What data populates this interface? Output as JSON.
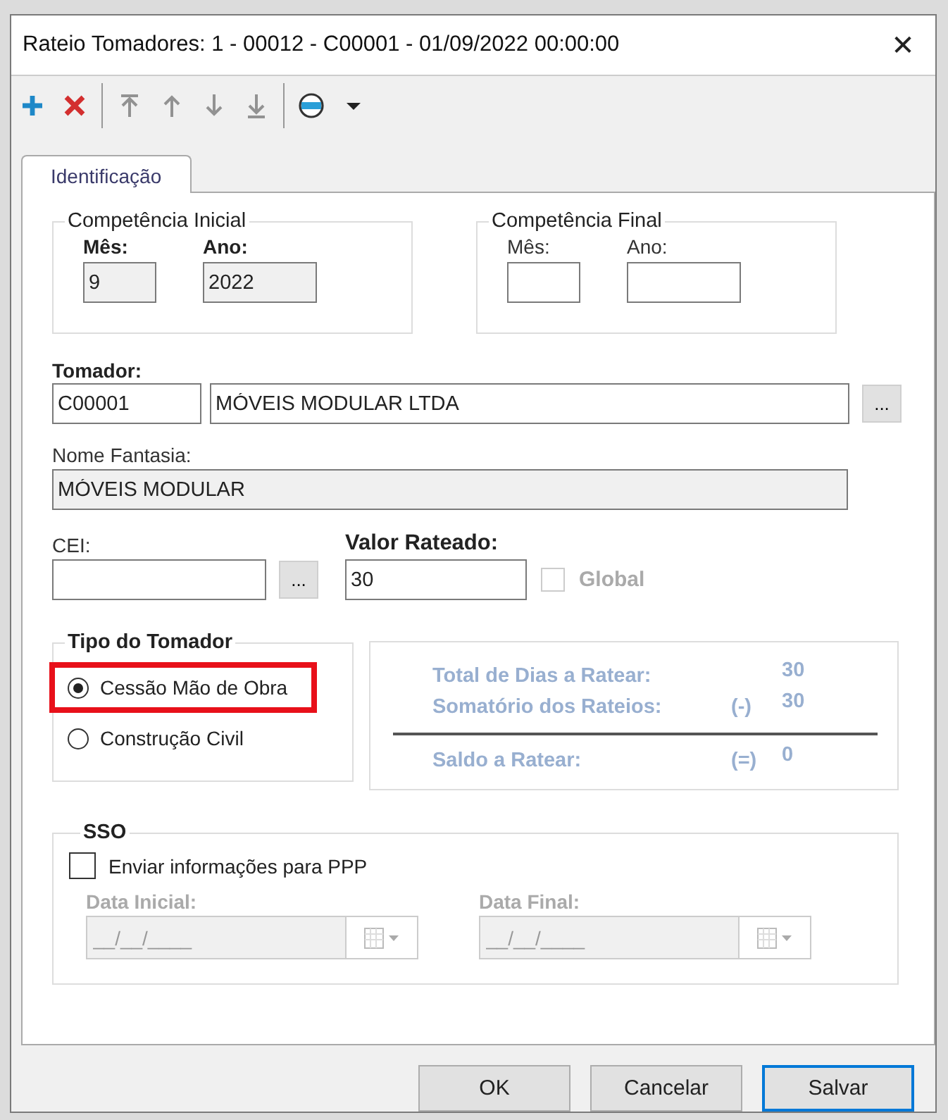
{
  "window": {
    "title": "Rateio Tomadores: 1 - 00012 - C00001 - 01/09/2022 00:00:00",
    "close": "✕"
  },
  "toolbar": [
    {
      "buttons": [
        {
          "kind": "add",
          "disabled": false
        },
        {
          "kind": "delete",
          "disabled": false
        }
      ]
    },
    {
      "buttons": [
        {
          "kind": "first",
          "disabled": true
        },
        {
          "kind": "up",
          "disabled": true
        },
        {
          "kind": "down",
          "disabled": true
        },
        {
          "kind": "last",
          "disabled": true
        }
      ]
    },
    {
      "buttons": [
        {
          "kind": "web",
          "disabled": false
        },
        {
          "kind": "dropdown",
          "disabled": false
        }
      ]
    }
  ],
  "tabs": [
    {
      "label": "Identificação",
      "selected": true
    }
  ],
  "competencias": [
    {
      "title": "Competência Inicial",
      "fields": [
        {
          "label": "Mês:",
          "value": "9",
          "required": true,
          "disabled": true
        },
        {
          "label": "Ano:",
          "value": "2022",
          "required": true,
          "disabled": true
        }
      ]
    },
    {
      "title": "Competência Final",
      "fields": [
        {
          "label": "Mês:",
          "required": false,
          "disabled": false
        },
        {
          "label": "Ano:",
          "required": false,
          "disabled": false
        }
      ]
    }
  ],
  "tomador": {
    "label": "Tomador:",
    "code": "C00001",
    "name": "MÓVEIS MODULAR LTDA",
    "button": "..."
  },
  "nome_fantasia": {
    "label": "Nome Fantasia:",
    "value": "MÓVEIS MODULAR",
    "disabled": true
  },
  "cei": {
    "label": "CEI:",
    "button": "..."
  },
  "valor_rateado": {
    "label": "Valor Rateado:",
    "value": "30"
  },
  "global": {
    "label": "Global",
    "checked": false,
    "disabled": true
  },
  "tipo_do_tomador": {
    "title": "Tipo do Tomador",
    "options": [
      {
        "label": "Cessão Mão de Obra",
        "selected": true,
        "highlighted": true
      },
      {
        "label": "Construção Civil",
        "selected": false,
        "highlighted": false
      }
    ]
  },
  "summary": [
    {
      "label": "Total de Dias a Ratear:",
      "value": "30"
    },
    {
      "label": "Somatório dos Rateios:",
      "sign": "(-)",
      "value": "30"
    },
    {
      "label": "Saldo a Ratear:",
      "sign": "(=)",
      "value": "0"
    }
  ],
  "sso": {
    "title": "SSO",
    "checkbox": {
      "label": "Enviar informações para PPP",
      "checked": false
    },
    "dates": [
      {
        "label": "Data Inicial:",
        "placeholder": "__/__/____",
        "disabled": true
      },
      {
        "label": "Data Final:",
        "placeholder": "__/__/____",
        "disabled": true
      }
    ]
  },
  "buttons": [
    {
      "label": "OK",
      "focused": false
    },
    {
      "label": "Cancelar",
      "focused": false
    },
    {
      "label": "Salvar",
      "focused": true
    }
  ]
}
